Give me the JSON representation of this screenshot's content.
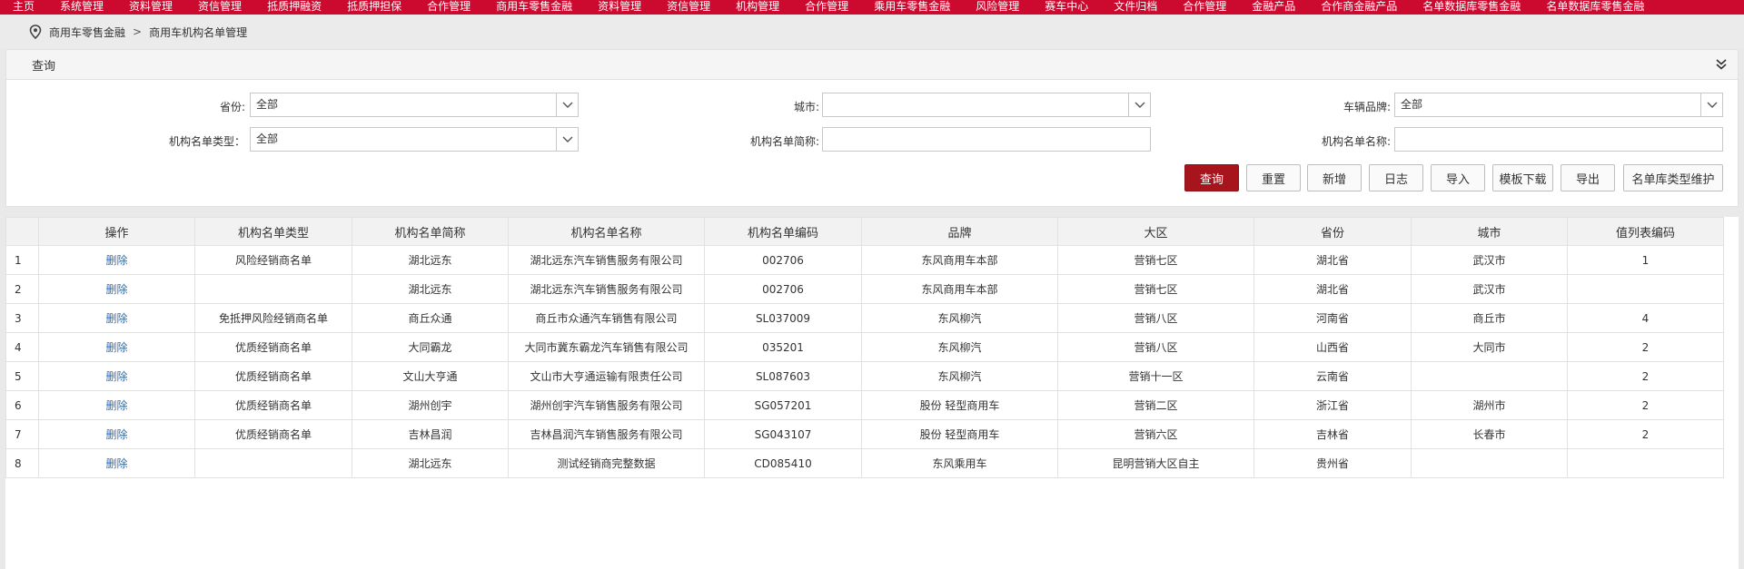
{
  "topnav": {
    "items": [
      "主页",
      "系统管理",
      "资料管理",
      "资信管理",
      "抵质押融资",
      "抵质押担保",
      "合作管理",
      "商用车零售金融",
      "资料管理",
      "资信管理",
      "机构管理",
      "合作管理",
      "乘用车零售金融",
      "风险管理",
      "赛车中心",
      "文件归档",
      "合作管理",
      "金融产品",
      "合作商金融产品",
      "名单数据库零售金融",
      "名单数据库零售金融"
    ]
  },
  "breadcrumb": {
    "root": "商用车零售金融",
    "separator": ">",
    "current": "商用车机构名单管理"
  },
  "query": {
    "title": "查询",
    "province_label": "省份:",
    "province_value": "全部",
    "city_label": "城市:",
    "city_value": "",
    "brand_label": "车辆品牌:",
    "brand_value": "全部",
    "type_label": "机构名单类型：",
    "type_value": "全部",
    "short_label": "机构名单简称:",
    "short_value": "",
    "name_label": "机构名单名称:",
    "name_value": ""
  },
  "buttons": {
    "search": "查询",
    "reset": "重置",
    "add": "新增",
    "log": "日志",
    "import": "导入",
    "template": "模板下载",
    "export": "导出",
    "maintain": "名单库类型维护"
  },
  "table": {
    "headers": [
      "",
      "操作",
      "机构名单类型",
      "机构名单简称",
      "机构名单名称",
      "机构名单编码",
      "品牌",
      "大区",
      "省份",
      "城市",
      "值列表编码"
    ],
    "rows": [
      [
        "1",
        "删除",
        "风险经销商名单",
        "湖北远东",
        "湖北远东汽车销售服务有限公司",
        "002706",
        "东风商用车本部",
        "营销七区",
        "湖北省",
        "武汉市",
        "1"
      ],
      [
        "2",
        "删除",
        "",
        "湖北远东",
        "湖北远东汽车销售服务有限公司",
        "002706",
        "东风商用车本部",
        "营销七区",
        "湖北省",
        "武汉市",
        ""
      ],
      [
        "3",
        "删除",
        "免抵押风险经销商名单",
        "商丘众通",
        "商丘市众通汽车销售有限公司",
        "SL037009",
        "东风柳汽",
        "营销八区",
        "河南省",
        "商丘市",
        "4"
      ],
      [
        "4",
        "删除",
        "优质经销商名单",
        "大同霸龙",
        "大同市冀东霸龙汽车销售有限公司",
        "035201",
        "东风柳汽",
        "营销八区",
        "山西省",
        "大同市",
        "2"
      ],
      [
        "5",
        "删除",
        "优质经销商名单",
        "文山大亨通",
        "文山市大亨通运输有限责任公司",
        "SL087603",
        "东风柳汽",
        "营销十一区",
        "云南省",
        "",
        "2"
      ],
      [
        "6",
        "删除",
        "优质经销商名单",
        "湖州创宇",
        "湖州创宇汽车销售服务有限公司",
        "SG057201",
        "股份 轻型商用车",
        "营销二区",
        "浙江省",
        "湖州市",
        "2"
      ],
      [
        "7",
        "删除",
        "优质经销商名单",
        "吉林昌润",
        "吉林昌润汽车销售服务有限公司",
        "SG043107",
        "股份 轻型商用车",
        "营销六区",
        "吉林省",
        "长春市",
        "2"
      ],
      [
        "8",
        "删除",
        "",
        "湖北远东",
        "测试经销商完整数据",
        "CD085410",
        "东风乘用车",
        "昆明营销大区自主",
        "贵州省",
        "",
        ""
      ]
    ]
  }
}
